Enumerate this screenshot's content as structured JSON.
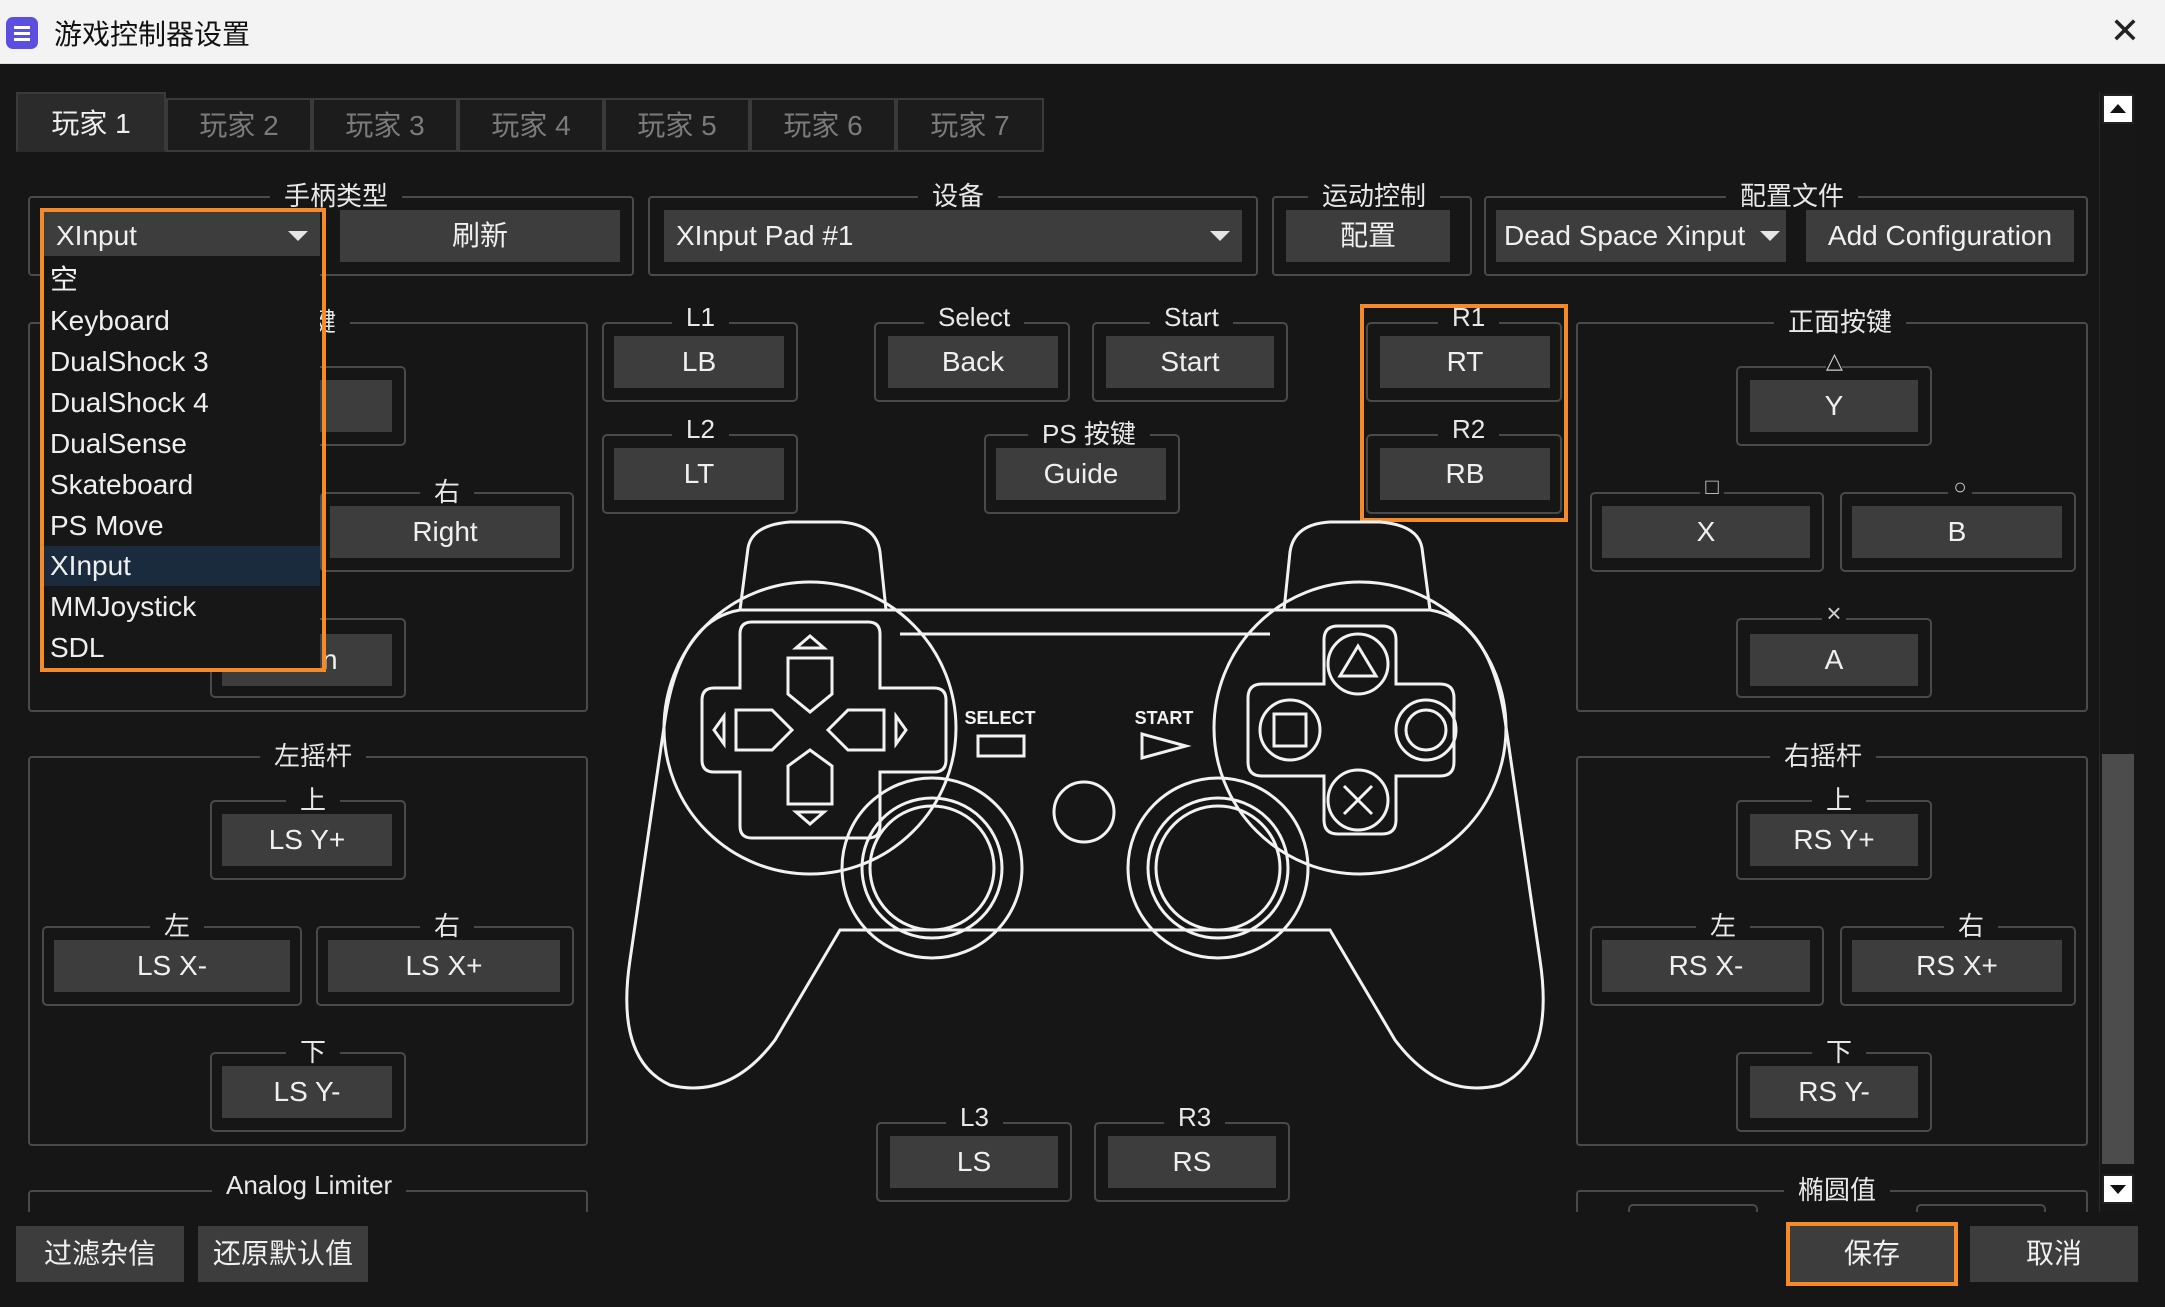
{
  "window": {
    "title": "游戏控制器设置"
  },
  "tabs": [
    "玩家 1",
    "玩家 2",
    "玩家 3",
    "玩家 4",
    "玩家 5",
    "玩家 6",
    "玩家 7"
  ],
  "handle_type": {
    "label": "手柄类型",
    "value": "XInput",
    "refresh": "刷新",
    "options": [
      "空",
      "Keyboard",
      "DualShock 3",
      "DualShock 4",
      "DualSense",
      "Skateboard",
      "PS Move",
      "XInput",
      "MMJoystick",
      "SDL"
    ],
    "selected": "XInput"
  },
  "device": {
    "label": "设备",
    "value": "XInput Pad #1"
  },
  "motion": {
    "label": "运动控制",
    "button": "配置"
  },
  "config_file": {
    "label": "配置文件",
    "value": "Dead Space Xinput",
    "add": "Add Configuration"
  },
  "dpad": {
    "label_tail": "键",
    "right_label": "右",
    "right": "Right",
    "down_tail": "n"
  },
  "shoulder": {
    "l1": "L1",
    "l1_btn": "LB",
    "l2": "L2",
    "l2_btn": "LT",
    "r1": "R1",
    "r1_btn": "RT",
    "r2": "R2",
    "r2_btn": "RB"
  },
  "center": {
    "select": "Select",
    "select_btn": "Back",
    "start": "Start",
    "start_btn": "Start",
    "ps": "PS 按键",
    "ps_btn": "Guide"
  },
  "face": {
    "label": "正面按键",
    "tri": "△",
    "tri_btn": "Y",
    "sq": "□",
    "sq_btn": "X",
    "ci": "○",
    "ci_btn": "B",
    "cr": "×",
    "cr_btn": "A"
  },
  "left_stick": {
    "label": "左摇杆",
    "up": "上",
    "up_btn": "LS Y+",
    "left": "左",
    "left_btn": "LS X-",
    "right": "右",
    "right_btn": "LS X+",
    "down": "下",
    "down_btn": "LS Y-"
  },
  "right_stick": {
    "label": "右摇杆",
    "up": "上",
    "up_btn": "RS Y+",
    "left": "左",
    "left_btn": "RS X-",
    "right": "右",
    "right_btn": "RS X+",
    "down": "下",
    "down_btn": "RS Y-"
  },
  "l3": {
    "label": "L3",
    "btn": "LS"
  },
  "r3": {
    "label": "R3",
    "btn": "RS"
  },
  "analog_limiter": "Analog Limiter",
  "ellipse": "椭圆值",
  "pad": {
    "select": "SELECT",
    "start": "START"
  },
  "footer": {
    "filter": "过滤杂信",
    "restore": "还原默认值",
    "save": "保存",
    "cancel": "取消"
  },
  "colors": {
    "accent": "#f58a2b",
    "selection": "#1a2b3d"
  }
}
